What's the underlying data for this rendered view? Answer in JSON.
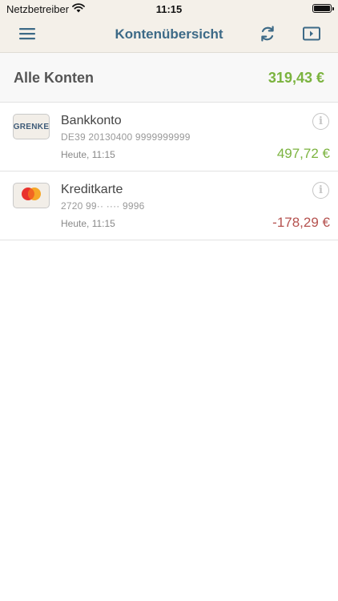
{
  "status_bar": {
    "carrier": "Netzbetreiber",
    "time": "11:15"
  },
  "nav": {
    "title": "Kontenübersicht",
    "icons": [
      "menu-icon",
      "sync-icon",
      "share-icon"
    ]
  },
  "summary": {
    "label": "Alle Konten",
    "total": "319,43 €"
  },
  "accounts": [
    {
      "logo_text": "GRENKE",
      "name": "Bankkonto",
      "iban": "DE39 20130400 9999999999",
      "date": "Heute, 11:15",
      "amount": "497,72 €",
      "amount_color": "#7bb33f"
    },
    {
      "logo_icon": "mastercard-icon",
      "name": "Kreditkarte",
      "iban": "2720 99·· ···· 9996",
      "date": "Heute, 11:15",
      "amount": "-178,29 €",
      "amount_color": "#b5524f"
    }
  ],
  "colors": {
    "accent": "#3d6a87",
    "positive": "#7bb33f",
    "negative": "#b5524f",
    "header_bg": "#f4f0e9"
  }
}
